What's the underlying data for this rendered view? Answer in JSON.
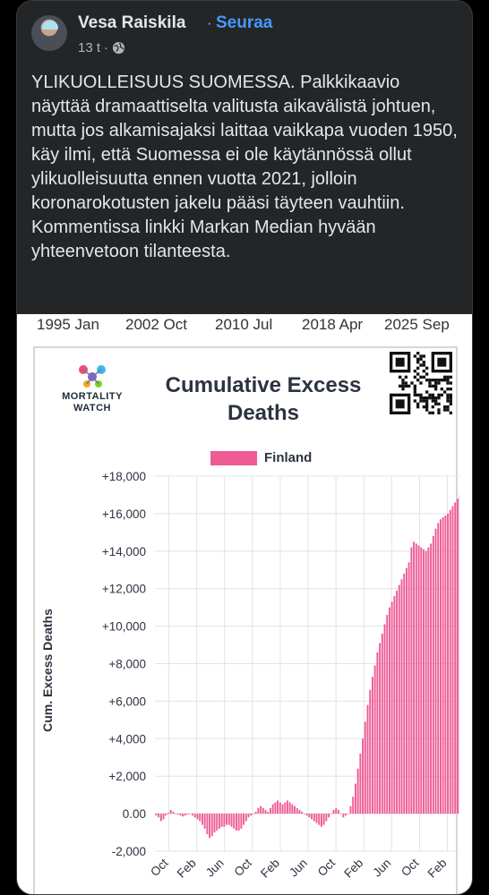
{
  "post": {
    "author": "Vesa Raiskila",
    "separator": "·",
    "follow_label": "Seuraa",
    "timestamp": "13 t",
    "meta_separator": "·",
    "audience_icon": "globe-icon",
    "text": "YLIKUOLLEISUUS SUOMESSA. Palkkikaavio näyttää dramaattiselta valitusta aikavälistä johtuen, mutta jos alkamisajaksi laittaa vaikkapa vuoden 1950, käy ilmi, että Suomessa ei ole käytännössä ollut ylikuolleisuutta ennen vuotta 2021, jolloin koronarokotusten jakelu pääsi täyteen vauhtiin. Kommentissa linkki Markan Median hyvään yhteenvetoon tilanteesta."
  },
  "slider_axis": [
    "1995 Jan",
    "2002 Oct",
    "2010 Jul",
    "2018 Apr",
    "2025 Sep"
  ],
  "logo": {
    "line1": "MORTALITY",
    "line2": "WATCH"
  },
  "chart_data": {
    "type": "bar",
    "title": "Cumulative Excess Deaths",
    "ylabel": "Cum. Excess Deaths",
    "legend": [
      {
        "name": "Finland",
        "color": "#ef5b95"
      }
    ],
    "ylim": [
      -2000,
      18000
    ],
    "yticks": [
      "+18,000",
      "+16,000",
      "+14,000",
      "+12,000",
      "+10,000",
      "+8,000",
      "+6,000",
      "+4,000",
      "+2,000",
      "0.00",
      "-2,000"
    ],
    "ytick_values": [
      18000,
      16000,
      14000,
      12000,
      10000,
      8000,
      6000,
      4000,
      2000,
      0,
      -2000
    ],
    "xticks": [
      "Oct",
      "Feb",
      "Jun",
      "Oct",
      "Feb",
      "Jun",
      "Oct",
      "Feb",
      "Jun",
      "Oct",
      "Feb"
    ],
    "grid": true,
    "legend_position": "top-center",
    "series": [
      {
        "name": "Finland",
        "values": [
          -100,
          -200,
          -400,
          -300,
          -100,
          50,
          200,
          100,
          0,
          -50,
          -100,
          -150,
          -100,
          -50,
          0,
          -100,
          -200,
          -300,
          -400,
          -600,
          -800,
          -1100,
          -1300,
          -1200,
          -1000,
          -900,
          -800,
          -700,
          -700,
          -600,
          -600,
          -700,
          -800,
          -900,
          -900,
          -800,
          -600,
          -400,
          -200,
          -100,
          0,
          100,
          300,
          400,
          300,
          200,
          100,
          300,
          500,
          600,
          700,
          600,
          500,
          600,
          700,
          600,
          500,
          400,
          300,
          200,
          100,
          0,
          -100,
          -200,
          -300,
          -400,
          -500,
          -600,
          -700,
          -600,
          -400,
          -200,
          0,
          200,
          300,
          200,
          0,
          -200,
          -100,
          0,
          400,
          900,
          1600,
          2400,
          3200,
          4000,
          4900,
          5800,
          6600,
          7300,
          7900,
          8600,
          9100,
          9600,
          10100,
          10600,
          11000,
          11300,
          11600,
          11900,
          12200,
          12500,
          12800,
          13100,
          13400,
          14200,
          14500,
          14400,
          14300,
          14200,
          14100,
          14000,
          14200,
          14400,
          14800,
          15200,
          15500,
          15700,
          15800,
          15900,
          16000,
          16200,
          16400,
          16600,
          16800,
          17000
        ]
      }
    ]
  }
}
